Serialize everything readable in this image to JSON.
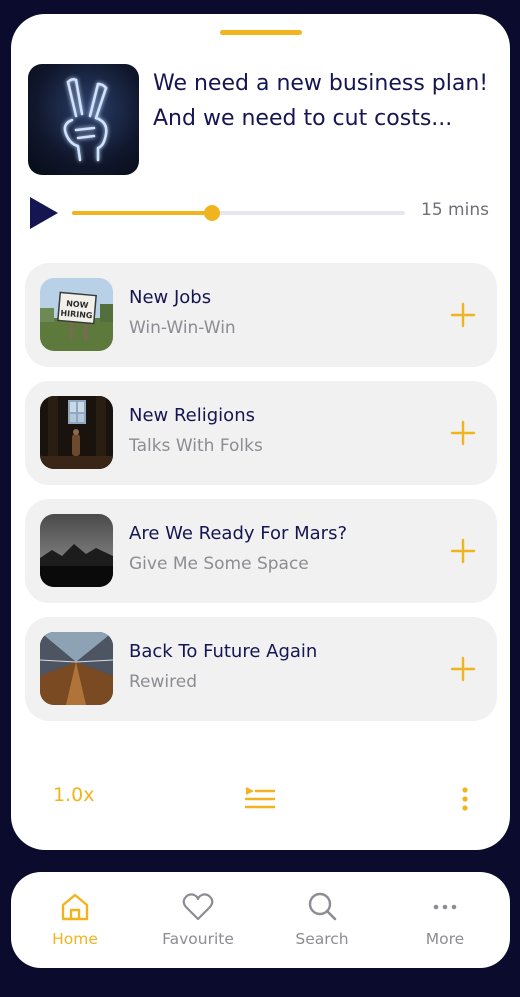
{
  "player": {
    "title": "We need a new business plan! And we need to cut costs...",
    "duration": "15 mins",
    "progress": 0.42
  },
  "episodes": [
    {
      "title": "New Jobs",
      "subtitle": "Win-Win-Win",
      "thumb": "now-hiring-sign"
    },
    {
      "title": "New Religions",
      "subtitle": "Talks With Folks",
      "thumb": "dark-chapel"
    },
    {
      "title": "Are We Ready For Mars?",
      "subtitle": "Give Me Some Space",
      "thumb": "mountain-night"
    },
    {
      "title": "Back To Future Again",
      "subtitle": "Rewired",
      "thumb": "corridor"
    }
  ],
  "controls": {
    "speed": "1.0x"
  },
  "nav": [
    {
      "label": "Home",
      "icon": "home-icon",
      "active": true
    },
    {
      "label": "Favourite",
      "icon": "heart-icon",
      "active": false
    },
    {
      "label": "Search",
      "icon": "search-icon",
      "active": false
    },
    {
      "label": "More",
      "icon": "more-icon",
      "active": false
    }
  ],
  "colors": {
    "accent": "#f0b51e",
    "navy": "#151651",
    "background": "#0b0b2e"
  }
}
